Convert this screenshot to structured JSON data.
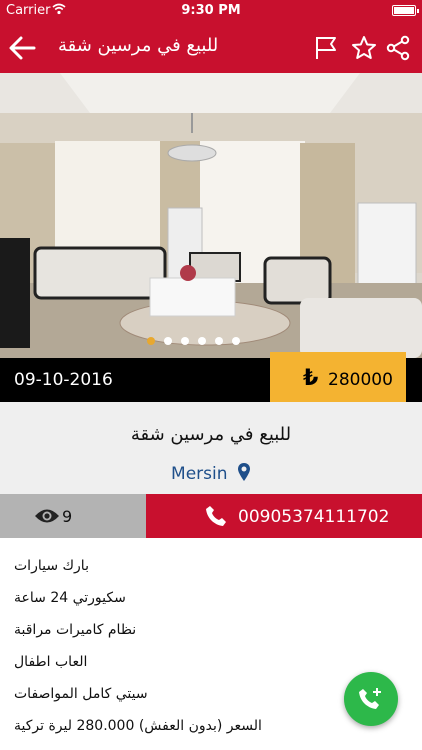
{
  "status_bar": {
    "carrier": "Carrier",
    "time": "9:30 PM"
  },
  "header": {
    "title": "للبيع في مرسين شقة"
  },
  "listing": {
    "date": "09-10-2016",
    "price_currency": "₺",
    "price": "280000",
    "title": "للبيع في مرسين شقة",
    "location": "Mersin",
    "views": "9",
    "phone": "00905374111702"
  },
  "gallery": {
    "image_count": 6,
    "active_index": 0
  },
  "features": [
    "بارك سيارات",
    "سكيورتي 24 ساعة",
    "نظام كاميرات مراقبة",
    "العاب اطفال",
    "سيتي كامل المواصفات",
    "السعر (بدون العفش) 280.000 ليرة تركية"
  ],
  "colors": {
    "brand_red": "#c8102e",
    "price_gold": "#f4b331",
    "location_blue": "#1f4f8a",
    "fab_green": "#2db84a"
  }
}
